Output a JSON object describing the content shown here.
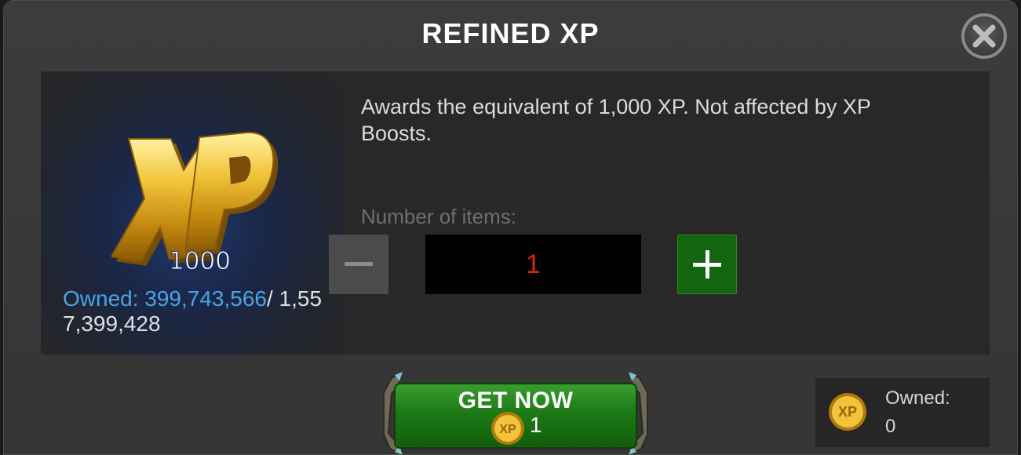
{
  "dialog": {
    "title": "REFINED XP"
  },
  "item": {
    "icon": "xp-logo-icon",
    "amount_badge": "1000",
    "owned_label": "Owned: ",
    "owned_count": "399,743,566",
    "owned_max": "/ 1,557,399,428",
    "description": "Awards the equivalent of 1,000 XP. Not affected by XP Boosts."
  },
  "quantity": {
    "label": "Number of items:",
    "value": "1",
    "decrement_icon": "minus-icon",
    "increment_icon": "plus-icon"
  },
  "purchase": {
    "button_label": "GET NOW",
    "cost": "1",
    "currency_icon": "xp-coin-icon"
  },
  "currency_owned": {
    "label": "Owned:",
    "value": "0"
  },
  "colors": {
    "accent_green": "#1d7a16",
    "owned_blue": "#4aa3e6",
    "quantity_red": "#d8221a"
  }
}
